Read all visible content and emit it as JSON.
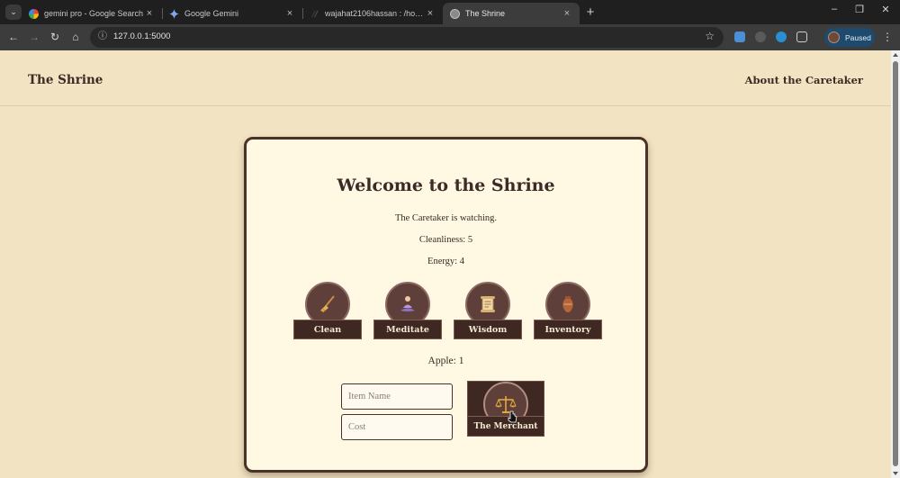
{
  "browser": {
    "tabs": [
      {
        "title": "gemini pro - Google Search",
        "icon": "google-icon",
        "active": false
      },
      {
        "title": "Google Gemini",
        "icon": "gemini-icon",
        "active": false
      },
      {
        "title": "wajahat2106hassan : /home/wajahat2106hassan",
        "icon": "terminal-icon",
        "active": false
      },
      {
        "title": "The Shrine",
        "icon": "globe-icon",
        "active": true
      }
    ],
    "close_glyph": "×",
    "new_tab_glyph": "+",
    "url": "127.0.0.1:5000",
    "profile_status": "Paused",
    "window_controls": {
      "minimize": "–",
      "restore": "❐",
      "close": "✕"
    }
  },
  "site": {
    "brand": "The Shrine",
    "nav_link": "About the Caretaker"
  },
  "shrine": {
    "title": "Welcome to the Shrine",
    "watching": "The Caretaker is watching.",
    "cleanliness": "Cleanliness: 5",
    "energy": "Energy: 4",
    "actions": [
      {
        "label": "Clean",
        "icon": "broom-icon"
      },
      {
        "label": "Meditate",
        "icon": "meditation-icon"
      },
      {
        "label": "Wisdom",
        "icon": "scroll-icon"
      },
      {
        "label": "Inventory",
        "icon": "vase-icon"
      }
    ],
    "inventory_line": "Apple: 1",
    "item_name_placeholder": "Item Name",
    "cost_placeholder": "Cost",
    "merchant_label": "The Merchant",
    "merchant_icon": "scales-icon"
  },
  "colors": {
    "page_bg": "#f2e4c2",
    "card_bg": "#fff8e3",
    "dark_brown": "#3f2822",
    "text": "#3b2a25"
  }
}
